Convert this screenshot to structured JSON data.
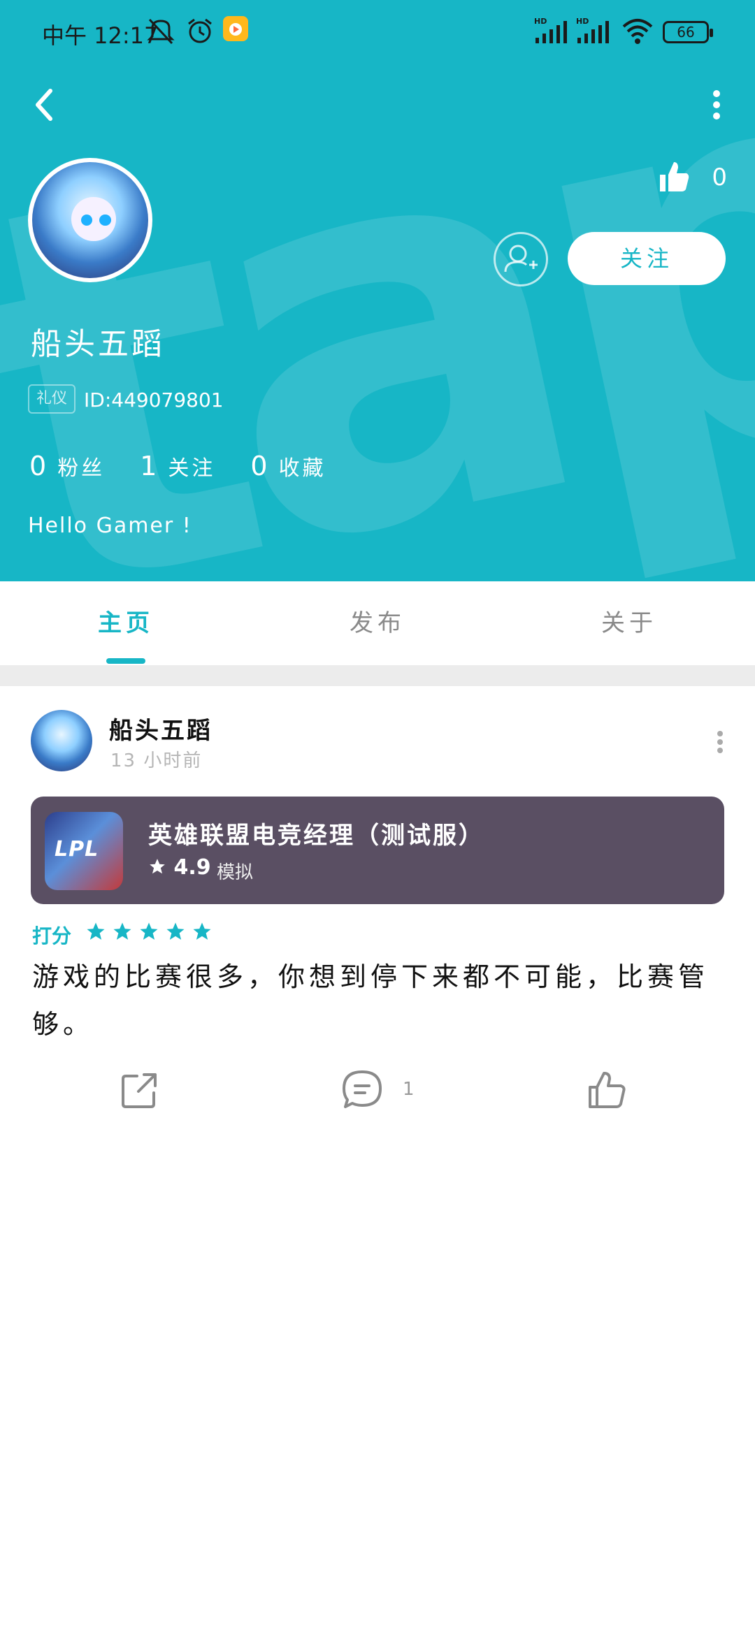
{
  "status_bar": {
    "time": "中午 12:17",
    "battery": "66"
  },
  "profile": {
    "like_count": "0",
    "follow_label": "关注",
    "username": "船头五蹈",
    "badge": "礼仪",
    "user_id": "ID:449079801",
    "stats": [
      {
        "num": "0",
        "label": "粉丝"
      },
      {
        "num": "1",
        "label": "关注"
      },
      {
        "num": "0",
        "label": "收藏"
      }
    ],
    "bio": "Hello Gamer !"
  },
  "tabs": [
    {
      "label": "主页",
      "active": true
    },
    {
      "label": "发布",
      "active": false
    },
    {
      "label": "关于",
      "active": false
    }
  ],
  "post": {
    "username": "船头五蹈",
    "time": "13 小时前",
    "game": {
      "title": "英雄联盟电竞经理（测试服）",
      "rating": "4.9",
      "tag": "模拟",
      "icon_text": "LPL"
    },
    "score_label": "打分",
    "stars": 5,
    "content": "游戏的比赛很多，你想到停下来都不可能，比赛管够。",
    "comment_count": "1"
  },
  "colors": {
    "accent": "#17b6c6",
    "card": "#5a4f63"
  }
}
